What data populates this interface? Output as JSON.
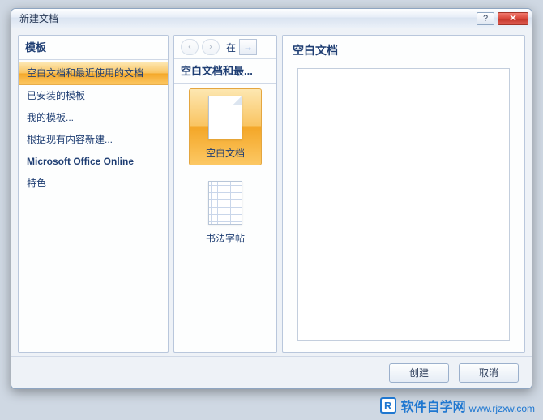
{
  "window": {
    "title": "新建文档",
    "help_label": "?",
    "close_label": "✕"
  },
  "sidebar": {
    "header": "模板",
    "items": [
      {
        "label": "空白文档和最近使用的文档",
        "selected": true
      },
      {
        "label": "已安装的模板"
      },
      {
        "label": "我的模板..."
      },
      {
        "label": "根据现有内容新建..."
      },
      {
        "label": "Microsoft Office Online",
        "bold": true
      },
      {
        "label": "特色"
      }
    ]
  },
  "middle": {
    "nav": {
      "in_label": "在",
      "arrow": "→"
    },
    "header": "空白文档和最...",
    "items": [
      {
        "label": "空白文档",
        "type": "blank",
        "selected": true
      },
      {
        "label": "书法字帖",
        "type": "calligraphy"
      }
    ]
  },
  "preview": {
    "title": "空白文档"
  },
  "buttons": {
    "create": "创建",
    "cancel": "取消"
  },
  "watermark": {
    "badge": "R",
    "brand": "软件自学网",
    "url": "www.rjzxw.com"
  }
}
